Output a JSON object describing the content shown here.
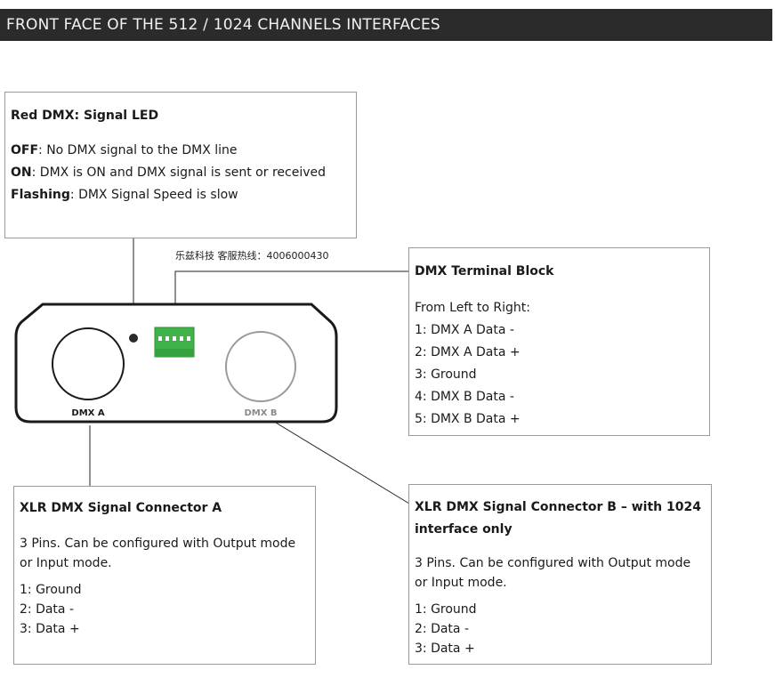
{
  "header": {
    "title": "FRONT FACE OF THE 512 / 1024 CHANNELS INTERFACES"
  },
  "hotline": "乐兹科技 客服热线：4006000430",
  "device": {
    "port_a_label": "DMX A",
    "port_b_label": "DMX B"
  },
  "led_box": {
    "title": "Red DMX: Signal LED",
    "lines": [
      {
        "key": "OFF",
        "text": ": No DMX signal to the DMX line"
      },
      {
        "key": "ON",
        "text": ": DMX is ON and DMX signal is sent or received"
      },
      {
        "key": "Flashing",
        "text": ": DMX Signal Speed is slow"
      }
    ]
  },
  "terminal_box": {
    "title": "DMX Terminal Block",
    "intro": "From Left to Right:",
    "items": [
      "1: DMX A Data -",
      "2: DMX A Data +",
      "3: Ground",
      "4: DMX B Data -",
      "5: DMX B Data +"
    ]
  },
  "xlr_a_box": {
    "title": "XLR DMX Signal Connector A",
    "description": "3 Pins. Can be configured with Output mode or Input mode.",
    "items": [
      "1: Ground",
      "2: Data -",
      "3: Data +"
    ]
  },
  "xlr_b_box": {
    "title": "XLR DMX Signal Connector B – with 1024 interface only",
    "description": "3 Pins. Can be configured with Output mode or Input mode.",
    "items": [
      "1: Ground",
      "2: Data -",
      "3: Data +"
    ]
  },
  "colors": {
    "header_bg": "#2b2b2b",
    "terminal_green": "#3fb24a",
    "device_outline": "#1a1a1a",
    "port_b_label": "#8a8a8a"
  }
}
